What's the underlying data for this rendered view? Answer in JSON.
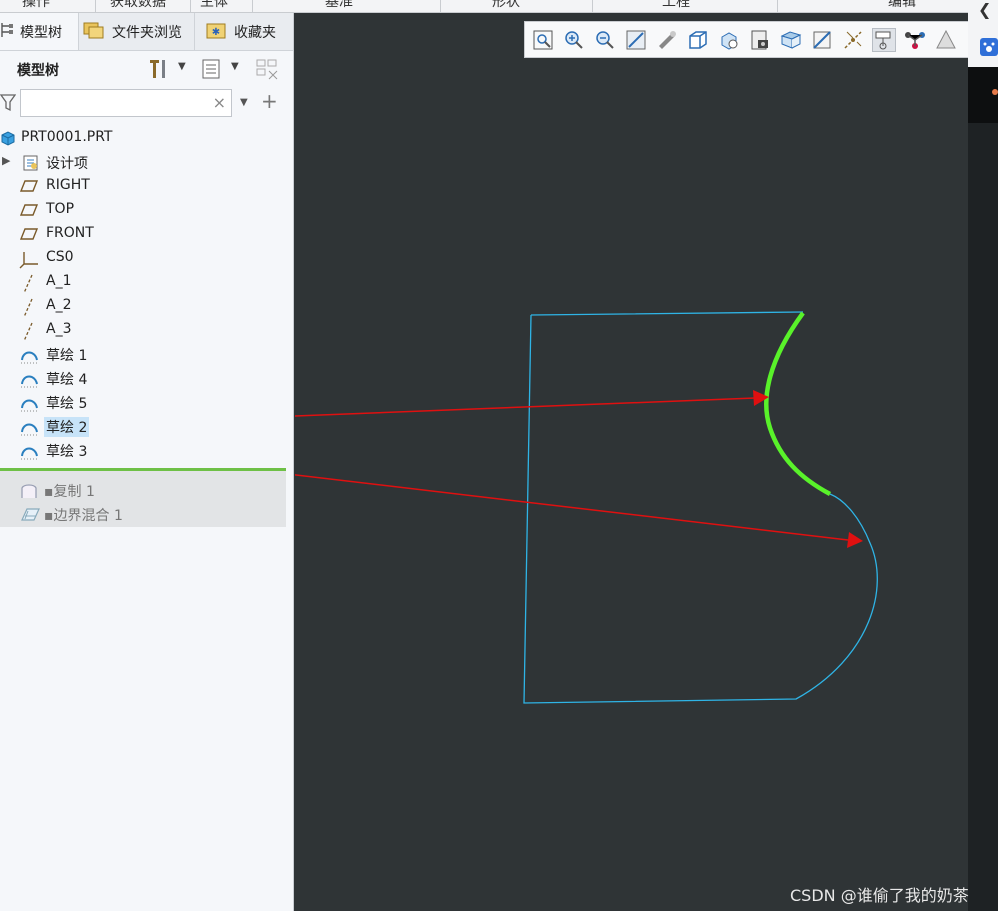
{
  "ribbon": {
    "items": [
      "操作",
      "获取数据",
      "主体",
      "基准",
      "形状",
      "工程",
      "编辑"
    ]
  },
  "tabs": [
    {
      "label": "模型树",
      "icon": "model-tree-icon",
      "active": true
    },
    {
      "label": "文件夹浏览",
      "icon": "folder-browser-icon",
      "active": false
    },
    {
      "label": "收藏夹",
      "icon": "favorites-icon",
      "active": false
    }
  ],
  "tree": {
    "title": "模型树",
    "search_value": "",
    "clear_symbol": "×",
    "add_symbol": "+",
    "root": "PRT0001.PRT",
    "items": [
      {
        "label": "设计项",
        "icon": "design-items-icon"
      },
      {
        "label": "RIGHT",
        "icon": "datum-plane-icon"
      },
      {
        "label": "TOP",
        "icon": "datum-plane-icon"
      },
      {
        "label": "FRONT",
        "icon": "datum-plane-icon"
      },
      {
        "label": "CS0",
        "icon": "coordinate-system-icon"
      },
      {
        "label": "A_1",
        "icon": "datum-axis-icon"
      },
      {
        "label": "A_2",
        "icon": "datum-axis-icon"
      },
      {
        "label": "A_3",
        "icon": "datum-axis-icon"
      },
      {
        "label": "草绘 1",
        "icon": "sketch-icon"
      },
      {
        "label": "草绘 4",
        "icon": "sketch-icon"
      },
      {
        "label": "草绘 5",
        "icon": "sketch-icon"
      },
      {
        "label": "草绘 2",
        "icon": "sketch-icon",
        "selected": true
      },
      {
        "label": "草绘 3",
        "icon": "sketch-icon"
      }
    ],
    "inactive_items": [
      {
        "label": "复制 1",
        "icon": "copy-feature-icon"
      },
      {
        "label": "边界混合 1",
        "icon": "boundary-blend-icon"
      }
    ]
  },
  "colors": {
    "sketch_curve": "#2fb4e6",
    "highlight_curve": "#59f22a",
    "annotation_arrow": "#e01010",
    "viewport_bg": "#2f3436",
    "insert_line": "#6ec046",
    "selection": "#c7e3f8"
  },
  "toolbar": {
    "icons": [
      "refit-icon",
      "zoom-in-icon",
      "zoom-out-icon",
      "repaint-icon",
      "shading-icon",
      "display-style-icon",
      "saved-orientations-icon",
      "view-manager-icon",
      "perspective-icon",
      "section-icon",
      "datum-display-icon",
      "annotation-display-icon",
      "spin-center-icon",
      "appearance-icon"
    ]
  },
  "watermark": "CSDN @谁偷了我的奶茶"
}
